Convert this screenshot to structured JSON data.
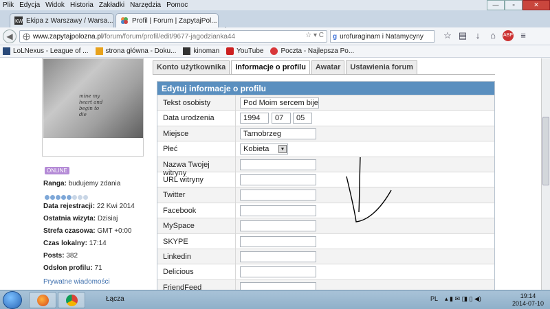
{
  "menu": [
    "Plik",
    "Edycja",
    "Widok",
    "Historia",
    "Zakładki",
    "Narzędzia",
    "Pomoc"
  ],
  "window_controls": {
    "minimize": "—",
    "maximize": "▫",
    "close": "✕"
  },
  "tabs": [
    {
      "label": "Ekipa z Warszawy / Warsa..."
    },
    {
      "label": "Profil | Forum | ZapytajPol..."
    }
  ],
  "new_tab": "+",
  "nav": {
    "back": "◀",
    "url_host": "www.zapytajpolozna.pl",
    "url_path": "/forum/forum/profil/edit/9677-jagodzianka44",
    "url_controls": "☆ ▾ C",
    "search_engine": "g",
    "search_value": "urofuraginam i Natamycyny",
    "icons": [
      "☆",
      "▤",
      "↓",
      "⌂",
      "ABP",
      "≡"
    ]
  },
  "bookmarks": [
    {
      "label": "LoLNexus - League of ...",
      "color": "#2a4a7a"
    },
    {
      "label": "strona główna - Doku...",
      "color": "#e8a21c"
    },
    {
      "label": "kinoman",
      "color": "#333333"
    },
    {
      "label": "YouTube",
      "color": "#cc2020"
    },
    {
      "label": "Poczta - Najlepsza Po...",
      "color": "#d8373a"
    }
  ],
  "profile": {
    "photo_text": "mine my heart and begin to die",
    "status": "ONLINE",
    "rank_label": "Ranga:",
    "rank_value": "budujemy zdania",
    "rank_dots_filled": 5,
    "rank_dots_total": 8,
    "reg_label": "Data rejestracji:",
    "reg_value": "22 Kwi 2014",
    "visit_label": "Ostatnia wizyta:",
    "visit_value": "Dzisiaj",
    "tz_label": "Strefa czasowa:",
    "tz_value": "GMT +0:00",
    "local_label": "Czas lokalny:",
    "local_value": "17:14",
    "posts_label": "Posts:",
    "posts_value": "382",
    "views_label": "Odsłon profilu:",
    "views_value": "71",
    "pm_link": "Prywatne wiadomości"
  },
  "settings_tabs": [
    "Konto użytkownika",
    "Informacje o profilu",
    "Awatar",
    "Ustawienia forum"
  ],
  "form": {
    "header": "Edytuj informacje o profilu",
    "rows": [
      {
        "label": "Tekst osobisty",
        "value": "Pod Moim sercem bije i"
      },
      {
        "label": "Data urodzenia",
        "year": "1994",
        "month": "07",
        "day": "05"
      },
      {
        "label": "Miejsce",
        "value": "Tarnobrzeg"
      },
      {
        "label": "Płeć",
        "value": "Kobieta"
      },
      {
        "label": "Nazwa Twojej witryny",
        "value": ""
      },
      {
        "label": "URL witryny",
        "value": ""
      },
      {
        "label": "Twitter",
        "value": ""
      },
      {
        "label": "Facebook",
        "value": ""
      },
      {
        "label": "MySpace",
        "value": ""
      },
      {
        "label": "SKYPE",
        "value": ""
      },
      {
        "label": "Linkedin",
        "value": ""
      },
      {
        "label": "Delicious",
        "value": ""
      },
      {
        "label": "FriendFeed",
        "value": ""
      }
    ]
  },
  "taskbar": {
    "label": "Łącza",
    "lang": "PL",
    "time": "19:14",
    "date": "2014-07-10"
  }
}
